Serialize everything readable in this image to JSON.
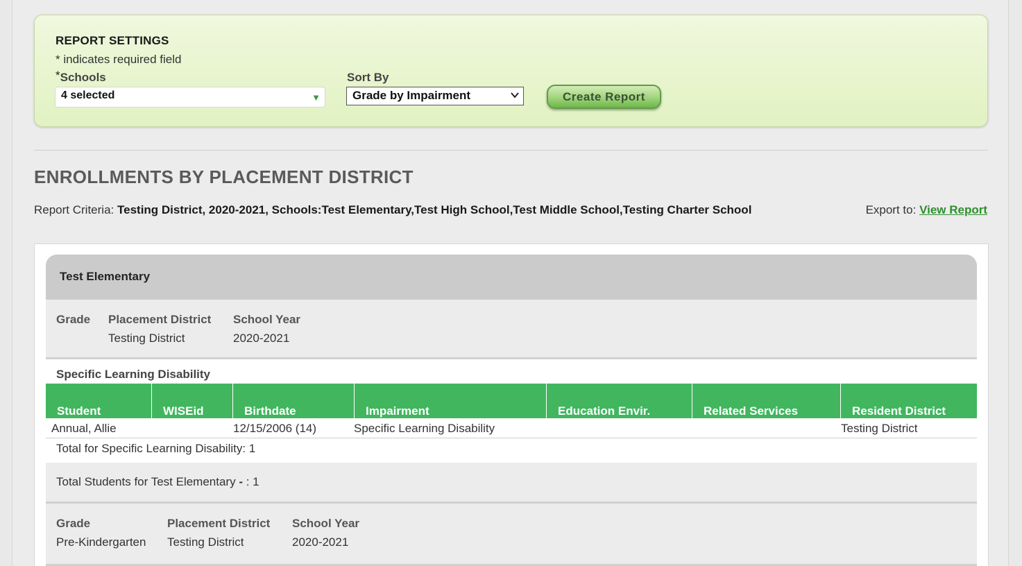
{
  "settings": {
    "title": "REPORT SETTINGS",
    "required_note": "* indicates required field",
    "schools_star": "*",
    "schools_label": "Schools",
    "schools_value": "4 selected",
    "sort_label": "Sort By",
    "sort_value": "Grade by Impairment",
    "create_button": "Create Report"
  },
  "report": {
    "title": "ENROLLMENTS BY PLACEMENT DISTRICT",
    "criteria_label": "Report Criteria:",
    "criteria_value": "Testing District, 2020-2021, Schools:Test Elementary,Test High School,Test Middle School,Testing Charter School",
    "export_label": "Export to:",
    "export_link": "View Report"
  },
  "school": {
    "name": "Test Elementary",
    "grade_blocks": [
      {
        "grade_label": "Grade",
        "placement_label": "Placement District",
        "year_label": "School Year",
        "grade_value": "",
        "placement_value": "Testing District",
        "year_value": "2020-2021"
      },
      {
        "grade_label": "Grade",
        "placement_label": "Placement District",
        "year_label": "School Year",
        "grade_value": "Pre-Kindergarten",
        "placement_value": "Testing District",
        "year_value": "2020-2021"
      }
    ],
    "impairment_group": "Specific Learning Disability",
    "columns": [
      "Student",
      "WISEid",
      "Birthdate",
      "Impairment",
      "Education Envir.",
      "Related Services",
      "Resident District"
    ],
    "rows": [
      {
        "student": "Annual, Allie",
        "wiseid": "",
        "birthdate": "12/15/2006 (14)",
        "impairment": "Specific Learning Disability",
        "environment": "",
        "services": "",
        "resident": "Testing District"
      }
    ],
    "impairment_total": "Total for Specific Learning Disability: 1",
    "school_total_prefix": "Total Students for Test Elementary ",
    "school_total_dash": "-",
    "school_total_suffix": " : 1"
  },
  "colors": {
    "accent_green": "#41b65e",
    "link_green": "#2e8f2e",
    "settings_bg": "#e2f2c2",
    "header_gray": "#cbcbcb"
  }
}
